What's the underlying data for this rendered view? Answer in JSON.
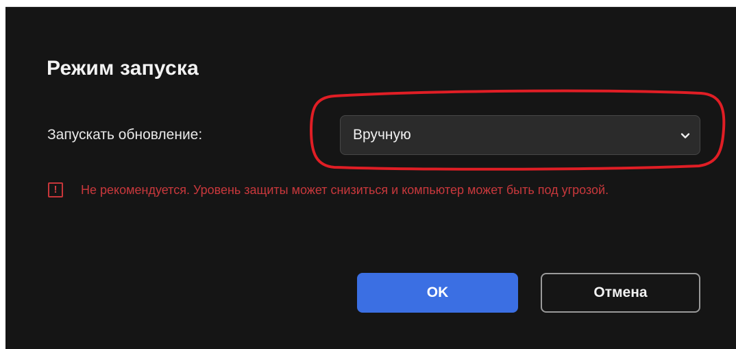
{
  "dialog": {
    "title": "Режим запуска",
    "field_label": "Запускать обновление:",
    "select": {
      "value": "Вручную"
    },
    "warning": {
      "icon": "warning-exclamation-icon",
      "icon_glyph": "!",
      "text": "Не рекомендуется. Уровень защиты может снизиться и компьютер может быть под угрозой."
    },
    "buttons": {
      "ok_label": "OK",
      "cancel_label": "Отмена"
    }
  },
  "colors": {
    "dialog_bg": "#151515",
    "accent_blue": "#3b6fe3",
    "warning_red": "#c9383c",
    "highlight_red": "#e01e25"
  }
}
